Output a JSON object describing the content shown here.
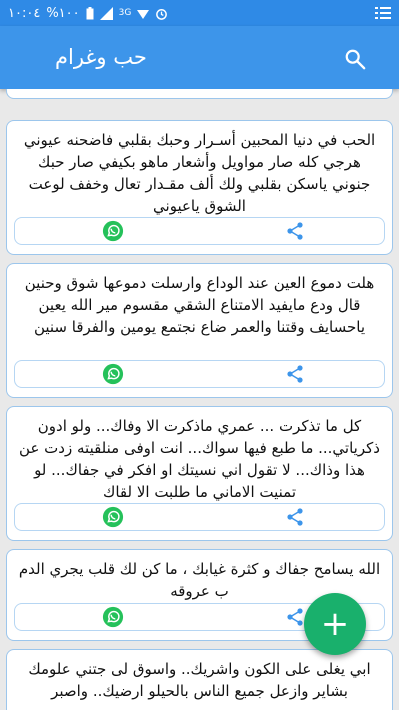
{
  "status_bar": {
    "time": "١٠:٠٤",
    "battery": "%١٠٠",
    "network": "3G"
  },
  "app_bar": {
    "title": "حب وغرام",
    "search_icon": "search-icon",
    "menu_icon": "list-icon"
  },
  "posts": [
    {
      "text": "الحب في دنيا المحبين أسـرار وحبك بقلبي فاضحنه عيوني هرجي كله صار مواويل وأشعار ماهو بكيفي صار حبك جنوني ياسكن بقلبي ولك ألف مقـدار تعال وخفف لوعت الشوق ياعيوني"
    },
    {
      "text": "هلت دموع العين عند الوداع وارسلت دموعها شوق وحنين قال ودع مايفيد الامتناع الشقي مقسوم مير الله يعين ياحسايف وقتنا والعمر ضاع نجتمع يومين والفرقا سنين"
    },
    {
      "text": "كل ما تذكرت ... عمري ماذكرت الا وفاك... ولو ادون ذكرياتي... ما طبع فيها سواك... انت اوفى منلقيته زدت عن هذا وذاك... لا تقول اني نسيتك او افكر في جفاك... لو تمنيت الاماني ما طلبت الا لقاك"
    },
    {
      "text": "الله يسامح جفاك و كثرة غيابك ، ما كن لك قلب يجري الدم ب عروقه"
    },
    {
      "text": "ابي يغلى على الكون واشريك.. واسوق لى جتني علومك بشاير وازعل جميع الناس بالحيلو ارضيك.. واصبر"
    }
  ],
  "fab": {
    "label": "+"
  },
  "colors": {
    "status_bar": "#2f8ae6",
    "app_bar": "#3d95ea",
    "card_border": "#9cc6ec",
    "whatsapp": "#25c15a",
    "share": "#3d95ea",
    "fab": "#19b06c"
  }
}
